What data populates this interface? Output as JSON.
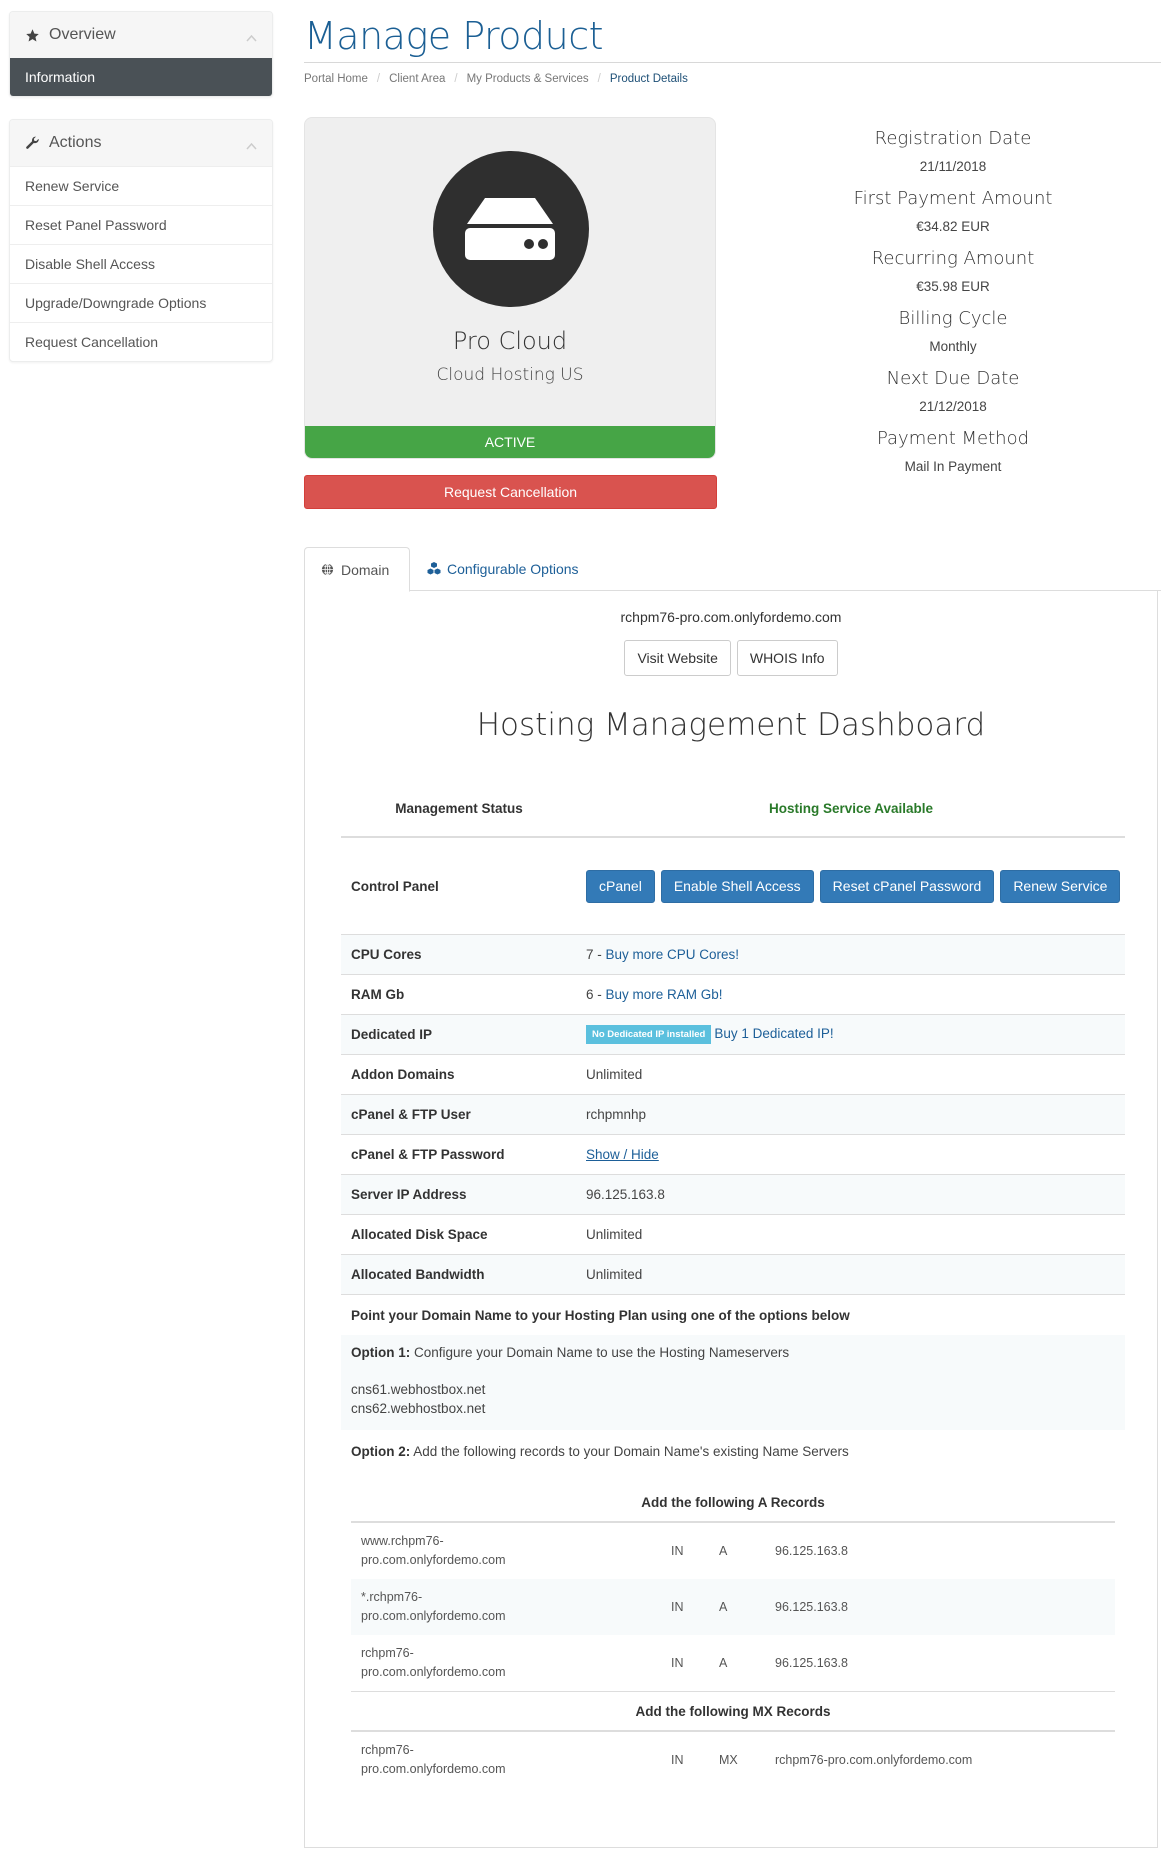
{
  "sidebar": {
    "overview": {
      "title": "Overview",
      "items": [
        {
          "label": "Information",
          "active": true
        }
      ]
    },
    "actions": {
      "title": "Actions",
      "items": [
        {
          "label": "Renew Service"
        },
        {
          "label": "Reset Panel Password"
        },
        {
          "label": "Disable Shell Access"
        },
        {
          "label": "Upgrade/Downgrade Options"
        },
        {
          "label": "Request Cancellation"
        }
      ]
    }
  },
  "header": {
    "title": "Manage Product",
    "breadcrumb": [
      "Portal Home",
      "Client Area",
      "My Products & Services",
      "Product Details"
    ]
  },
  "product": {
    "icon": "server-icon",
    "name": "Pro Cloud",
    "group": "Cloud Hosting US",
    "status": "ACTIVE",
    "status_color": "#46a546",
    "cancel_label": "Request Cancellation",
    "cancel_color": "#d9534f"
  },
  "billing": [
    {
      "label": "Registration Date",
      "value": "21/11/2018"
    },
    {
      "label": "First Payment Amount",
      "value": "€34.82 EUR"
    },
    {
      "label": "Recurring Amount",
      "value": "€35.98 EUR"
    },
    {
      "label": "Billing Cycle",
      "value": "Monthly"
    },
    {
      "label": "Next Due Date",
      "value": "21/12/2018"
    },
    {
      "label": "Payment Method",
      "value": "Mail In Payment"
    }
  ],
  "tabs": [
    {
      "label": "Domain",
      "icon": "globe-icon",
      "active": true
    },
    {
      "label": "Configurable Options",
      "icon": "cubes-icon",
      "active": false
    }
  ],
  "domain": {
    "name": "rchpm76-pro.com.onlyfordemo.com",
    "visit_label": "Visit Website",
    "whois_label": "WHOIS Info"
  },
  "dashboard": {
    "title": "Hosting Management Dashboard",
    "status_label": "Management Status",
    "status_value": "Hosting Service Available",
    "status_color": "#2a7a2a",
    "control_panel_label": "Control Panel",
    "control_buttons": [
      "cPanel",
      "Enable Shell Access",
      "Reset cPanel Password",
      "Renew Service"
    ],
    "rows": {
      "cpu": {
        "label": "CPU Cores",
        "value": "7",
        "link": "Buy more CPU Cores!"
      },
      "ram": {
        "label": "RAM Gb",
        "value": "6",
        "link": "Buy more RAM Gb!"
      },
      "ip": {
        "label": "Dedicated IP",
        "badge": "No Dedicated IP installed",
        "link": "Buy 1 Dedicated IP!"
      },
      "addon": {
        "label": "Addon Domains",
        "value": "Unlimited"
      },
      "ftp_user": {
        "label": "cPanel & FTP User",
        "value": "rchpmnhp"
      },
      "ftp_pass": {
        "label": "cPanel & FTP Password",
        "value": "Show / Hide"
      },
      "server_ip": {
        "label": "Server IP Address",
        "value": "96.125.163.8"
      },
      "disk": {
        "label": "Allocated Disk Space",
        "value": "Unlimited"
      },
      "bandwidth": {
        "label": "Allocated Bandwidth",
        "value": "Unlimited"
      }
    },
    "point_title": "Point your Domain Name to your Hosting Plan using one of the options below",
    "option1": {
      "key": "Option 1:",
      "text": "Configure your Domain Name to use the Hosting Nameservers",
      "nameservers": [
        "cns61.webhostbox.net",
        "cns62.webhostbox.net"
      ]
    },
    "option2": {
      "key": "Option 2:",
      "text": "Add the following records to your Domain Name's existing Name Servers"
    },
    "a_records": {
      "title": "Add the following A Records",
      "rows": [
        {
          "host_1": "www.rchpm76-",
          "host_2": "pro.com.onlyfordemo.com",
          "class": "IN",
          "type": "A",
          "target": "96.125.163.8"
        },
        {
          "host_1": "*.rchpm76-",
          "host_2": "pro.com.onlyfordemo.com",
          "class": "IN",
          "type": "A",
          "target": "96.125.163.8"
        },
        {
          "host_1": "rchpm76-",
          "host_2": "pro.com.onlyfordemo.com",
          "class": "IN",
          "type": "A",
          "target": "96.125.163.8"
        }
      ]
    },
    "mx_records": {
      "title": "Add the following MX Records",
      "rows": [
        {
          "host_1": "rchpm76-",
          "host_2": "pro.com.onlyfordemo.com",
          "class": "IN",
          "type": "MX",
          "target": "rchpm76-pro.com.onlyfordemo.com"
        }
      ]
    }
  }
}
